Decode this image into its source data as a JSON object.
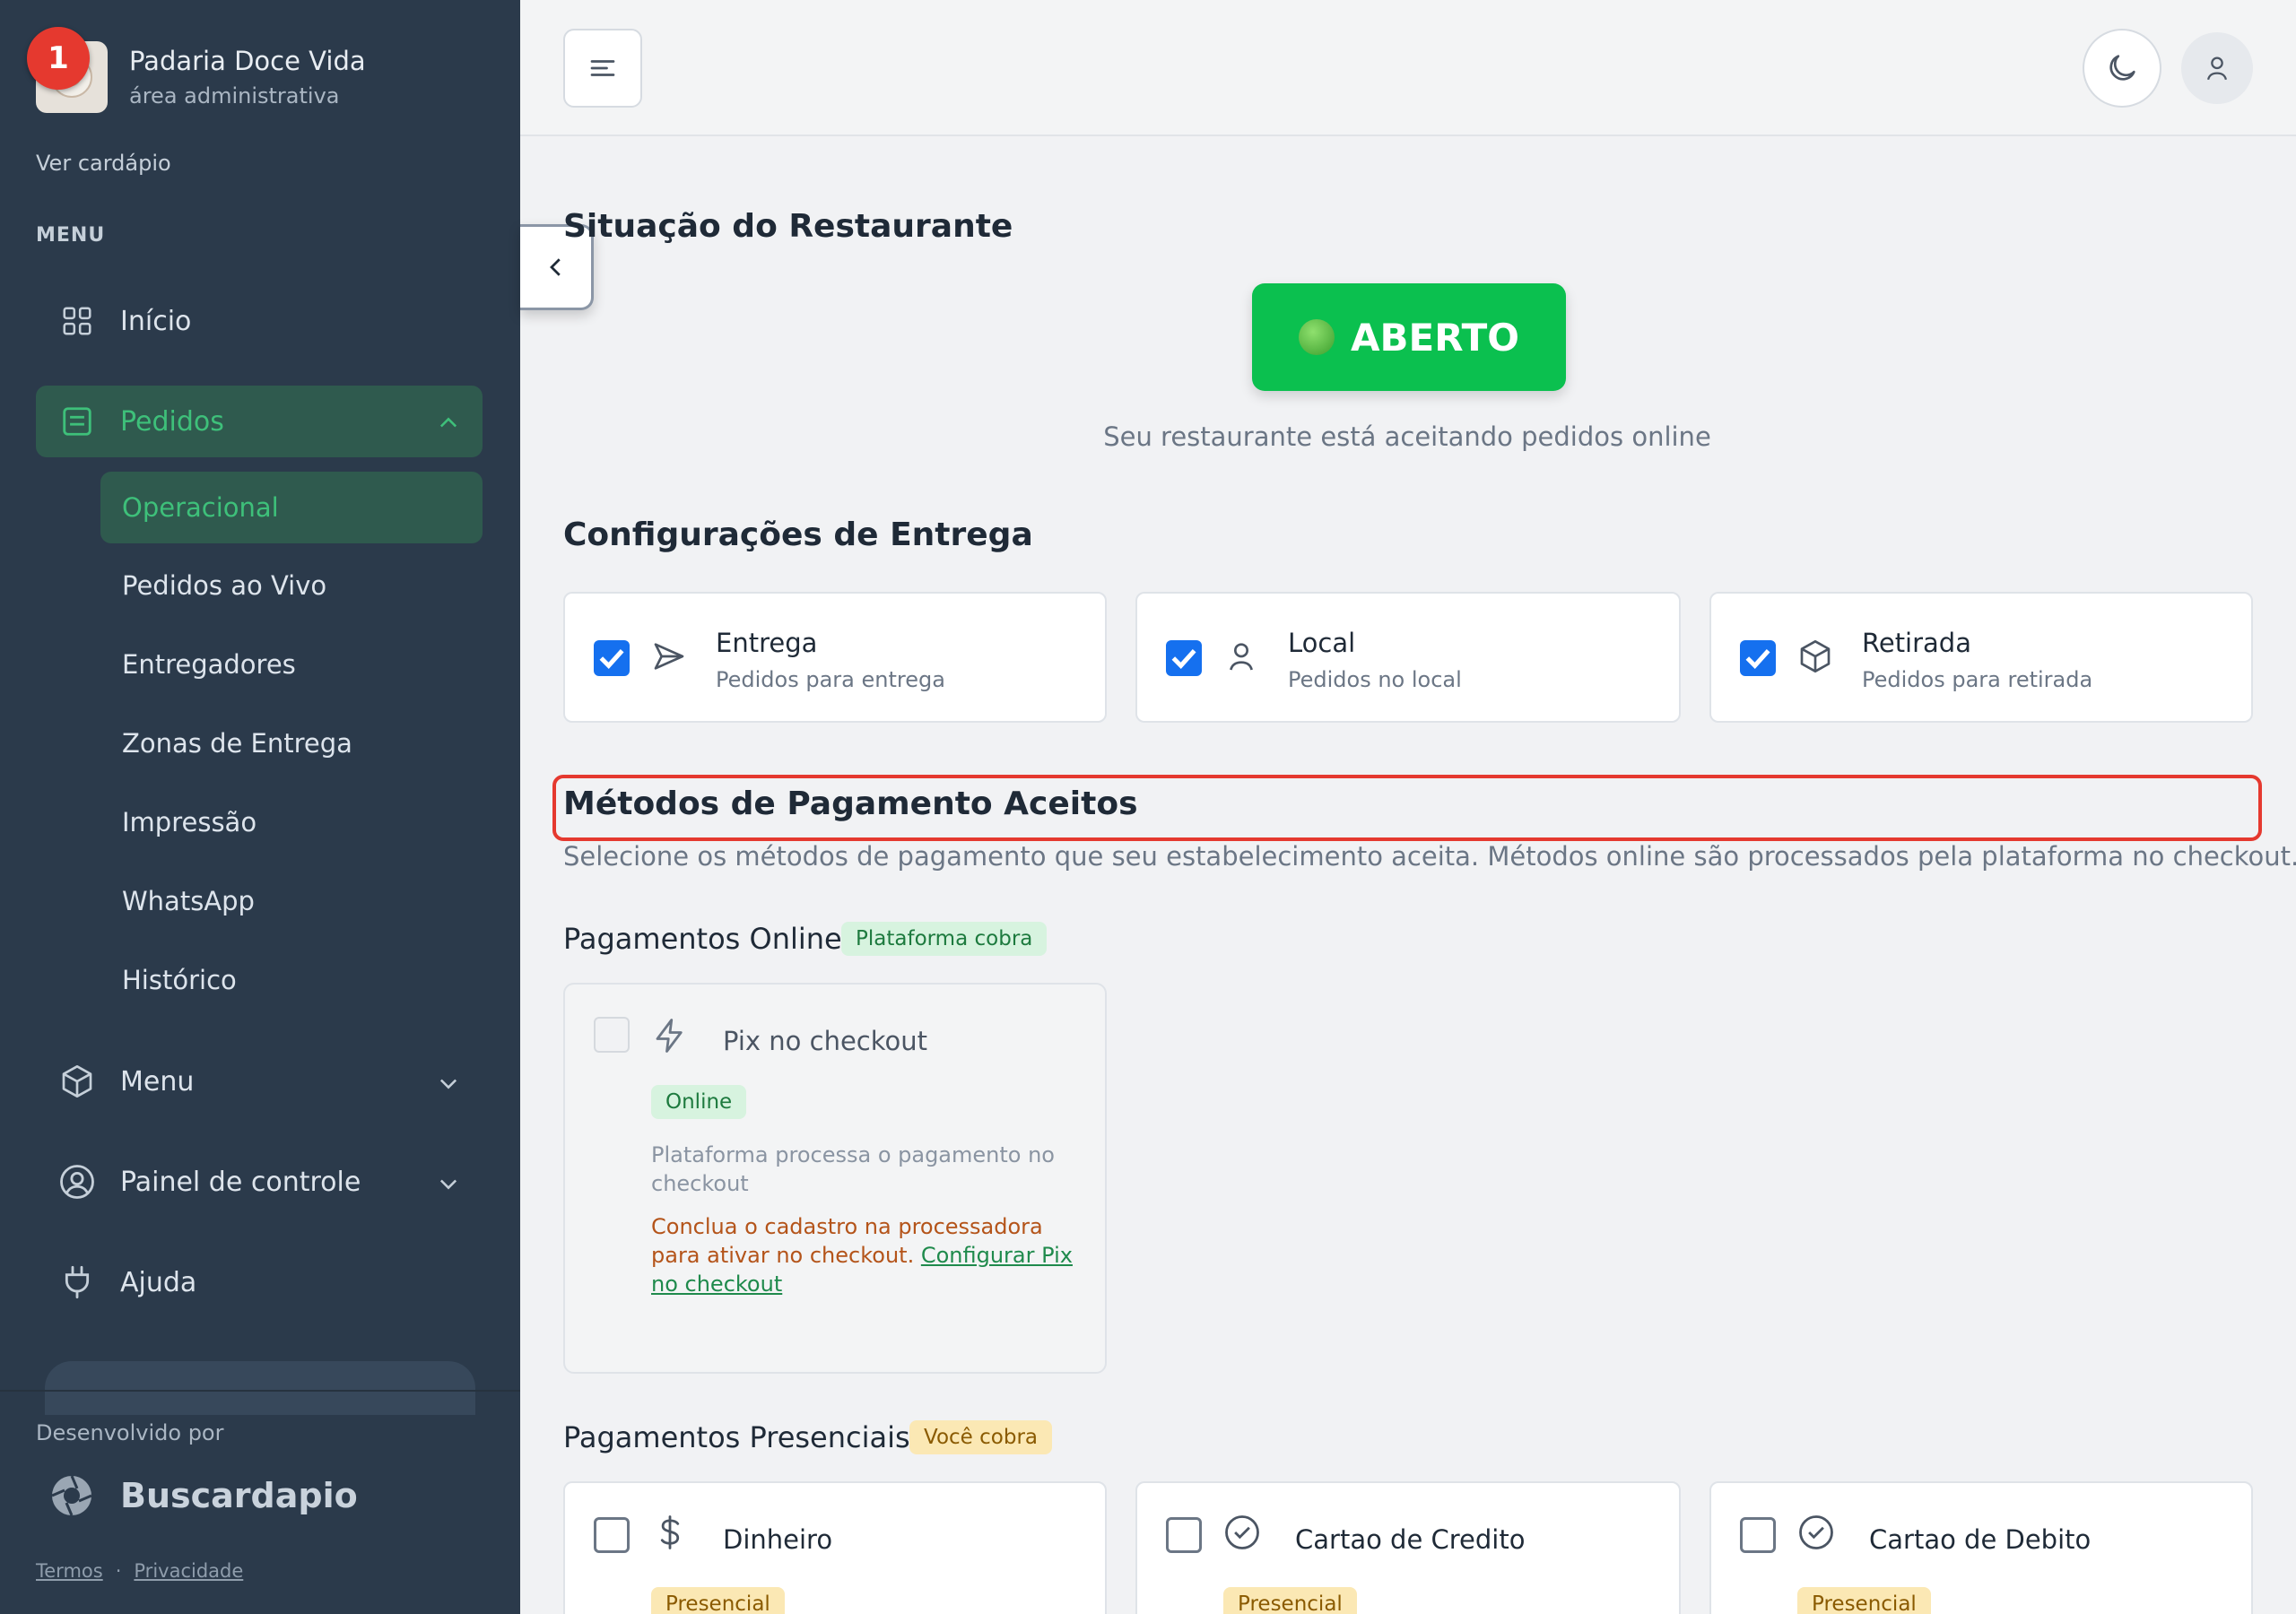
{
  "sidebar": {
    "notification_count": "1",
    "brand_name": "Padaria Doce Vida",
    "brand_sub": "área administrativa",
    "ver_cardapio": "Ver cardápio",
    "menu_heading": "MENU",
    "items": [
      {
        "label": "Início",
        "icon": "grid-icon"
      },
      {
        "label": "Pedidos",
        "icon": "list-icon",
        "expanded": true
      },
      {
        "label": "Menu",
        "icon": "box-icon"
      },
      {
        "label": "Painel de controle",
        "icon": "user-circle-icon"
      },
      {
        "label": "Ajuda",
        "icon": "plug-icon"
      }
    ],
    "subitems": [
      "Operacional",
      "Pedidos ao Vivo",
      "Entregadores",
      "Zonas de Entrega",
      "Impressão",
      "WhatsApp",
      "Histórico"
    ],
    "developed_by": "Desenvolvido por",
    "developer_name": "Buscardapio",
    "terms": "Termos",
    "privacy": "Privacidade",
    "separator": "·",
    "accent_color": "#3ec07a",
    "bg_color": "#2b3a4b"
  },
  "topbar": {
    "menu_icon": "hamburger-icon",
    "theme_icon": "moon-icon",
    "user_icon": "user-icon"
  },
  "main": {
    "status_title": "Situação do Restaurante",
    "status_button": "ABERTO",
    "status_color": "#0bc04f",
    "status_desc": "Seu restaurante está aceitando pedidos online",
    "delivery_title": "Configurações de Entrega",
    "delivery_options": [
      {
        "title": "Entrega",
        "sub": "Pedidos para entrega",
        "checked": true,
        "icon": "send-icon"
      },
      {
        "title": "Local",
        "sub": "Pedidos no local",
        "checked": true,
        "icon": "user-icon"
      },
      {
        "title": "Retirada",
        "sub": "Pedidos para retirada",
        "checked": true,
        "icon": "package-icon"
      }
    ],
    "payment_title": "Métodos de Pagamento Aceitos",
    "payment_desc": "Selecione os métodos de pagamento que seu estabelecimento aceita. Métodos online são processados pela plataforma no checkout.",
    "online_title": "Pagamentos Online",
    "online_badge": "Plataforma cobra",
    "pix": {
      "title": "Pix no checkout",
      "badge": "Online",
      "desc": "Plataforma processa o pagamento no checkout",
      "warning": "Conclua o cadastro na processadora para ativar no checkout.",
      "link": "Configurar Pix no checkout"
    },
    "presencial_title": "Pagamentos Presenciais",
    "presencial_badge": "Você cobra",
    "presencial_options": [
      {
        "title": "Dinheiro",
        "badge": "Presencial",
        "icon": "dollar-icon"
      },
      {
        "title": "Cartao de Credito",
        "badge": "Presencial",
        "icon": "check-circle-icon"
      },
      {
        "title": "Cartao de Debito",
        "badge": "Presencial",
        "icon": "check-circle-icon"
      }
    ]
  }
}
